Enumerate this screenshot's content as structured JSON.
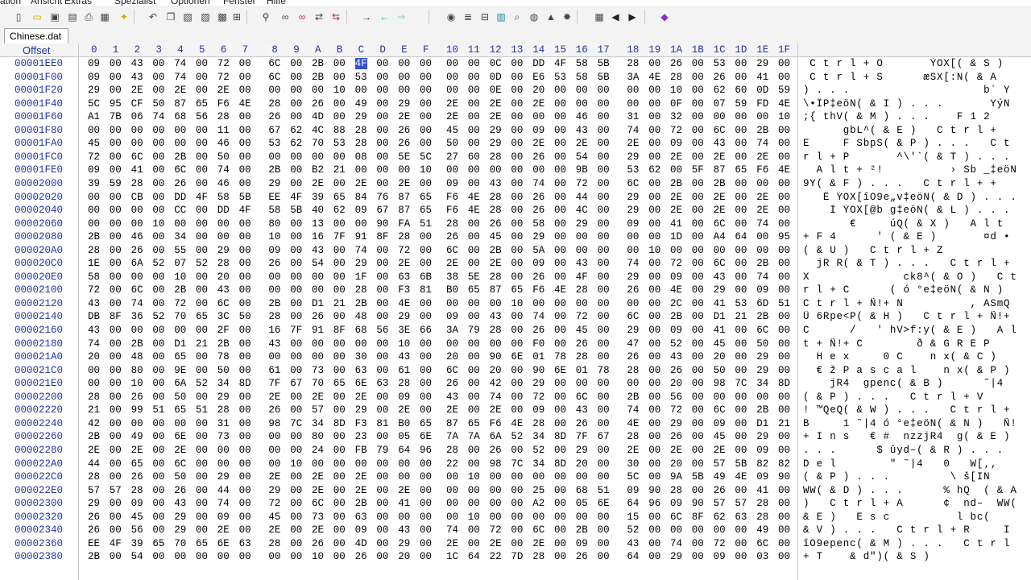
{
  "menu": [
    "ation",
    "Ansicht",
    "Extras",
    "Spezialist",
    "Optionen",
    "Fenster",
    "Hilfe"
  ],
  "toolbar_icons": [
    "new-file-icon",
    "open-folder-icon",
    "save-icon",
    "save-all-icon",
    "print-icon",
    "properties-icon",
    "star-icon",
    "undo-icon",
    "copy-icon",
    "paste-icon",
    "paste-special-icon",
    "clipboard-icon",
    "binary-hex-icon",
    "find-icon",
    "find-binoculars-icon",
    "find-hex-icon",
    "replace-icon",
    "replace-hex-icon",
    "goto-icon",
    "back-icon",
    "forward-icon",
    "disk-icon",
    "ram-icon",
    "drive-icon",
    "calculator-icon",
    "zoom-icon",
    "chat-icon",
    "image-icon",
    "gear-icon",
    "grid-icon",
    "prev-icon",
    "next-icon",
    "diamond-icon"
  ],
  "tab_label": "Chinese.dat",
  "offset_header": "Offset",
  "column_headers": [
    "0",
    "1",
    "2",
    "3",
    "4",
    "5",
    "6",
    "7",
    "8",
    "9",
    "A",
    "B",
    "C",
    "D",
    "E",
    "F",
    "10",
    "11",
    "12",
    "13",
    "14",
    "15",
    "16",
    "17",
    "18",
    "19",
    "1A",
    "1B",
    "1C",
    "1D",
    "1E",
    "1F"
  ],
  "cursor": {
    "row": 0,
    "col": 12
  },
  "rows": [
    {
      "offset": "00001EE0",
      "hex": "09 00 43 00 74 00 72 00 6C 00 2B 00 4F 00 00 00 00 00 0C 00 DD 4F 58 5B 28 00 26 00 53 00 29 00",
      "text": " C t r l + O       ÝOX[( & S )"
    },
    {
      "offset": "00001F00",
      "hex": "09 00 43 00 74 00 72 00 6C 00 2B 00 53 00 00 00 00 00 0D 00 E6 53 58 5B 3A 4E 28 00 26 00 41 00",
      "text": " C t r l + S      æSX[:N( & A"
    },
    {
      "offset": "00001F20",
      "hex": "29 00 2E 00 2E 00 2E 00 00 00 00 10 00 00 00 00 00 00 0E 00 20 00 00 00 00 00 10 00 62 60 0D 59",
      "text": ") . . .                    b` Y"
    },
    {
      "offset": "00001F40",
      "hex": "5C 95 CF 50 87 65 F6 4E 28 00 26 00 49 00 29 00 2E 00 2E 00 2E 00 00 00 00 00 0F 00 07 59 FD 4E",
      "text": "\\•ÏP‡eöN( & I ) . . .       YýN"
    },
    {
      "offset": "00001F60",
      "hex": "A1 7B 06 74 68 56 28 00 26 00 4D 00 29 00 2E 00 2E 00 2E 00 00 00 46 00 31 00 32 00 00 00 00 10",
      "text": ";{ thV( & M ) . . .    F 1 2"
    },
    {
      "offset": "00001F80",
      "hex": "00 00 00 00 00 00 11 00 67 62 4C 88 28 00 26 00 45 00 29 00 09 00 43 00 74 00 72 00 6C 00 2B 00",
      "text": "      gbL^( & E )   C t r l +"
    },
    {
      "offset": "00001FA0",
      "hex": "45 00 00 00 00 00 46 00 53 62 70 53 28 00 26 00 50 00 29 00 2E 00 2E 00 2E 00 09 00 43 00 74 00",
      "text": "E     F SbpS( & P ) . . .   C t"
    },
    {
      "offset": "00001FC0",
      "hex": "72 00 6C 00 2B 00 50 00 00 00 00 00 08 00 5E 5C 27 60 28 00 26 00 54 00 29 00 2E 00 2E 00 2E 00",
      "text": "r l + P       ^\\'`( & T ) . . ."
    },
    {
      "offset": "00001FE0",
      "hex": "09 00 41 00 6C 00 74 00 2B 00 B2 21 00 00 00 10 00 00 00 00 00 00 9B 00 53 62 00 5F 87 65 F6 4E",
      "text": "  A l t + ²!          › Sb _‡eöN"
    },
    {
      "offset": "00002000",
      "hex": "39 59 28 00 26 00 46 00 29 00 2E 00 2E 00 2E 00 09 00 43 00 74 00 72 00 6C 00 2B 00 2B 00 00 00",
      "text": "9Y( & F ) . . .   C t r l + +"
    },
    {
      "offset": "00002020",
      "hex": "00 00 CB 00 DD 4F 58 5B EE 4F 39 65 84 76 87 65 F6 4E 28 00 26 00 44 00 29 00 2E 00 2E 00 2E 00",
      "text": "   Ë ÝOX[îO9e„v‡eöN( & D ) . . ."
    },
    {
      "offset": "00002040",
      "hex": "00 00 00 00 CC 00 DD 4F 58 5B 40 62 09 67 87 65 F6 4E 28 00 26 00 4C 00 29 00 2E 00 2E 00 2E 00",
      "text": "    Ì ÝOX[@b g‡eöN( & L ) . . ."
    },
    {
      "offset": "00002060",
      "hex": "00 00 00 10 00 00 00 00 80 00 13 00 00 90 FA 51 28 00 26 00 58 00 29 00 09 00 41 00 6C 00 74 00",
      "text": "       €     úQ( & X )   A l t"
    },
    {
      "offset": "00002080",
      "hex": "2B 00 46 00 34 00 00 00 10 00 16 7F 91 8F 28 00 26 00 45 00 29 00 00 00 00 00 1D 00 A4 64 00 95",
      "text": "+ F 4      ' ( & E )       ¤d •"
    },
    {
      "offset": "000020A0",
      "hex": "28 00 26 00 55 00 29 00 09 00 43 00 74 00 72 00 6C 00 2B 00 5A 00 00 00 00 10 00 00 00 00 00 00",
      "text": "( & U )   C t r l + Z"
    },
    {
      "offset": "000020C0",
      "hex": "1E 00 6A 52 07 52 28 00 26 00 54 00 29 00 2E 00 2E 00 2E 00 09 00 43 00 74 00 72 00 6C 00 2B 00",
      "text": "  jR R( & T ) . . .   C t r l +"
    },
    {
      "offset": "000020E0",
      "hex": "58 00 00 00 10 00 20 00 00 00 00 00 1F 00 63 6B 38 5E 28 00 26 00 4F 00 29 00 09 00 43 00 74 00",
      "text": "X              ck8^( & O )   C t"
    },
    {
      "offset": "00002100",
      "hex": "72 00 6C 00 2B 00 43 00 00 00 00 00 28 00 F3 81 B0 65 87 65 F6 4E 28 00 26 00 4E 00 29 00 09 00",
      "text": "r l + C      ( ó °e‡eöN( & N )"
    },
    {
      "offset": "00002120",
      "hex": "43 00 74 00 72 00 6C 00 2B 00 D1 21 2B 00 4E 00 00 00 00 10 00 00 00 00 00 00 2C 00 41 53 6D 51",
      "text": "C t r l + Ñ!+ N          , ASmQ"
    },
    {
      "offset": "00002140",
      "hex": "DB 8F 36 52 70 65 3C 50 28 00 26 00 48 00 29 00 09 00 43 00 74 00 72 00 6C 00 2B 00 D1 21 2B 00",
      "text": "Û 6Rpe<P( & H )   C t r l + Ñ!+"
    },
    {
      "offset": "00002160",
      "hex": "43 00 00 00 00 00 2F 00 16 7F 91 8F 68 56 3E 66 3A 79 28 00 26 00 45 00 29 00 09 00 41 00 6C 00",
      "text": "C      /   ' hV>f:y( & E )   A l"
    },
    {
      "offset": "00002180",
      "hex": "74 00 2B 00 D1 21 2B 00 43 00 00 00 00 00 10 00 00 00 00 00 F0 00 26 00 47 00 52 00 45 00 50 00",
      "text": "t + Ñ!+ C        ð & G R E P"
    },
    {
      "offset": "000021A0",
      "hex": "20 00 48 00 65 00 78 00 00 00 00 00 30 00 43 00 20 00 90 6E 01 78 28 00 26 00 43 00 20 00 29 00",
      "text": "  H e x     0 C    n x( & C )"
    },
    {
      "offset": "000021C0",
      "hex": "00 00 80 00 9E 00 50 00 61 00 73 00 63 00 61 00 6C 00 20 00 90 6E 01 78 28 00 26 00 50 00 29 00",
      "text": "  € ž P a s c a l    n x( & P )"
    },
    {
      "offset": "000021E0",
      "hex": "00 00 10 00 6A 52 34 8D 7F 67 70 65 6E 63 28 00 26 00 42 00 29 00 00 00 00 00 20 00 98 7C 34 8D",
      "text": "    jR4  gpenc( & B )      ˜|4"
    },
    {
      "offset": "00002200",
      "hex": "28 00 26 00 50 00 29 00 2E 00 2E 00 2E 00 09 00 43 00 74 00 72 00 6C 00 2B 00 56 00 00 00 00 00",
      "text": "( & P ) . . .   C t r l + V"
    },
    {
      "offset": "00002220",
      "hex": "21 00 99 51 65 51 28 00 26 00 57 00 29 00 2E 00 2E 00 2E 00 09 00 43 00 74 00 72 00 6C 00 2B 00",
      "text": "! ™QeQ( & W ) . . .   C t r l +"
    },
    {
      "offset": "00002240",
      "hex": "42 00 00 00 00 00 31 00 98 7C 34 8D F3 81 B0 65 87 65 F6 4E 28 00 26 00 4E 00 29 00 09 00 D1 21",
      "text": "B     1 ˜|4 ó °e‡eöN( & N )   Ñ!"
    },
    {
      "offset": "00002260",
      "hex": "2B 00 49 00 6E 00 73 00 00 00 80 00 23 00 05 6E 7A 7A 6A 52 34 8D 7F 67 28 00 26 00 45 00 29 00",
      "text": "+ I n s   € #  nzzjR4  g( & E )"
    },
    {
      "offset": "00002280",
      "hex": "2E 00 2E 00 2E 00 00 00 00 00 24 00 FB 79 64 96 28 00 26 00 52 00 29 00 2E 00 2E 00 2E 00 09 00",
      "text": ". . .      $ ûyd–( & R ) . . ."
    },
    {
      "offset": "000022A0",
      "hex": "44 00 65 00 6C 00 00 00 00 10 00 00 00 00 00 00 22 00 98 7C 34 8D 20 00 30 00 20 00 57 5B 82 82",
      "text": "D e l        \" ˜|4   0   W[‚‚"
    },
    {
      "offset": "000022C0",
      "hex": "28 00 26 00 50 00 29 00 2E 00 2E 00 2E 00 00 00 00 10 00 00 00 00 00 00 5C 00 9A 5B 49 4E 09 90",
      "text": "( & P ) . . .         \\ š[IN"
    },
    {
      "offset": "000022E0",
      "hex": "57 57 28 00 26 00 44 00 29 00 2E 00 2E 00 2E 00 00 00 00 00 25 00 68 51 09 90 28 00 26 00 41 00",
      "text": "WW( & D ) . . .      % hQ  ( & A"
    },
    {
      "offset": "00002300",
      "hex": "29 00 09 00 43 00 74 00 72 00 6C 00 2B 00 41 00 00 00 00 00 A2 00 05 6E 64 96 09 90 57 57 28 00",
      "text": ")   C t r l + A      ¢  nd–  WW("
    },
    {
      "offset": "00002320",
      "hex": "26 00 45 00 29 00 09 00 45 00 73 00 63 00 00 00 00 10 00 00 00 00 00 00 15 00 6C 8F 62 63 28 00",
      "text": "& E )   E s c          l bc("
    },
    {
      "offset": "00002340",
      "hex": "26 00 56 00 29 00 2E 00 2E 00 2E 00 09 00 43 00 74 00 72 00 6C 00 2B 00 52 00 00 00 00 00 49 00",
      "text": "& V ) . . .   C t r l + R     I"
    },
    {
      "offset": "00002360",
      "hex": "EE 4F 39 65 70 65 6E 63 28 00 26 00 4D 00 29 00 2E 00 2E 00 2E 00 09 00 43 00 74 00 72 00 6C 00",
      "text": "îO9epenc( & M ) . . .   C t r l"
    },
    {
      "offset": "00002380",
      "hex": "2B 00 54 00 00 00 00 00 00 00 10 00 26 00 20 00 1C 64 22 7D 28 00 26 00 64 00 29 00 09 00 03 00",
      "text": "+ T    & d\")( & S )"
    }
  ]
}
